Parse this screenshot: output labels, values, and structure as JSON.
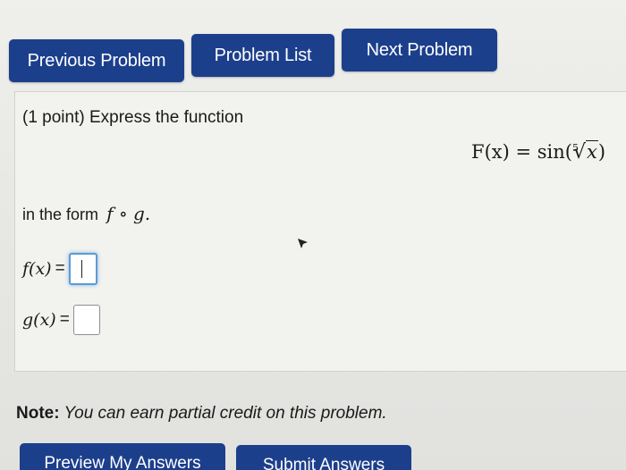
{
  "nav": {
    "previous_label": "Previous Problem",
    "list_label": "Problem List",
    "next_label": "Next Problem"
  },
  "problem": {
    "prompt": "(1 point) Express the function",
    "formula": {
      "lhs": "F(x) = sin(",
      "root_index": "5",
      "radicand": "x",
      "close": ")"
    },
    "form_text": "in the form",
    "form_math": "f ∘ g.",
    "f_label": "f(x)",
    "g_label": "g(x)",
    "equals": "=",
    "f_value": "",
    "g_value": ""
  },
  "note": {
    "bold": "Note:",
    "text": " You can earn partial credit on this problem."
  },
  "actions": {
    "preview_label": "Preview My Answers",
    "submit_label": "Submit Answers"
  },
  "colors": {
    "button_bg": "#1c3f8c",
    "focus_ring": "#5b9bd5"
  },
  "icons": {
    "cursor": "mouse-pointer-icon"
  }
}
